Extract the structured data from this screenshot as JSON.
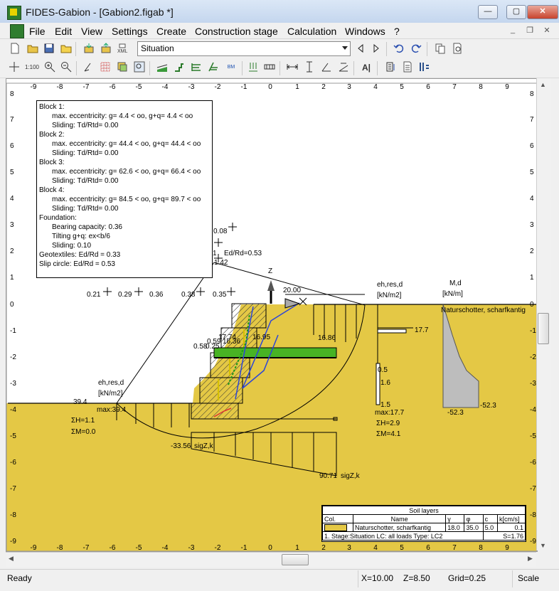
{
  "window": {
    "title": "FIDES-Gabion - [Gabion2.figab *]",
    "minimize_glyph": "—",
    "maximize_glyph": "▢",
    "close_glyph": "✕"
  },
  "menu": {
    "items": [
      "File",
      "Edit",
      "View",
      "Settings",
      "Create",
      "Construction stage",
      "Calculation",
      "Windows",
      "?"
    ],
    "mdi_minimize": "_",
    "mdi_restore": "❐",
    "mdi_close": "✕"
  },
  "toolbar": {
    "view_select": "Situation",
    "scale_label": "1:100",
    "ai_label": "A|",
    "bm_label": "BM"
  },
  "canvas": {
    "x_ticks": [
      "-9",
      "-8",
      "-7",
      "-6",
      "-5",
      "-4",
      "-3",
      "-2",
      "-1",
      "0",
      "1",
      "2",
      "3",
      "4",
      "5",
      "6",
      "7",
      "8",
      "9"
    ],
    "y_ticks": [
      "8",
      "7",
      "6",
      "5",
      "4",
      "3",
      "2",
      "1",
      "0",
      "-1",
      "-2",
      "-3",
      "-4",
      "-5",
      "-6",
      "-7",
      "-8",
      "-9"
    ],
    "soil_color": "#e4c845",
    "axis_label_z": "Z",
    "load_label": "20.00",
    "labels": {
      "ed_rd": "Ed/Rd=0.53",
      "v008": "0.08",
      "v142": "1.42",
      "one": "1",
      "pt021": "0.21",
      "pt029": "0.29",
      "pt036": "0.36",
      "pt038": "0.38",
      "pt035": "0.35",
      "v1774": "17.74",
      "v1695": "16.95",
      "v1686": "16.86",
      "v059": "0.59",
      "v1636": "16.36",
      "v058": "0.58",
      "v025": "0.25",
      "eh_left_1": "eh,res,d",
      "eh_left_2": "[kN/m2]",
      "v394": "39.4",
      "max394": "max:39.4",
      "sumh_left": "ΣH=1.1",
      "summ_left": "ΣM=0.0",
      "v3356": "-33.56",
      "sigz1": "sigZ,k",
      "v9071": "90.71",
      "sigz2": "sigZ,k",
      "eh_right_1": "eh,res,d",
      "eh_right_2": "[kN/m2]",
      "v177": "17.7",
      "v05": "0.5",
      "v16": "1.6",
      "v15": "1.5",
      "max177": "max:17.7",
      "sumh_right": "ΣH=2.9",
      "summ_right": "ΣM=4.1",
      "md_1": "M,d",
      "md_2": "[kN/m]",
      "soil_name": "Naturschotter, scharfkantig",
      "v523a": "-52.3",
      "v523b": "-52.3"
    }
  },
  "info": {
    "lines": [
      {
        "t": "Block 1:",
        "i": false
      },
      {
        "t": "max. eccentricity: g=  4.4 < oo, g+q=  4.4 < oo",
        "i": true
      },
      {
        "t": "Sliding: Td/Rtd= 0.00",
        "i": true
      },
      {
        "t": "Block 2:",
        "i": false
      },
      {
        "t": "max. eccentricity: g= 44.4 < oo, g+q= 44.4 < oo",
        "i": true
      },
      {
        "t": "Sliding: Td/Rtd= 0.00",
        "i": true
      },
      {
        "t": "Block 3:",
        "i": false
      },
      {
        "t": "max. eccentricity: g= 62.6 < oo, g+q= 66.4 < oo",
        "i": true
      },
      {
        "t": "Sliding: Td/Rtd= 0.00",
        "i": true
      },
      {
        "t": "Block 4:",
        "i": false
      },
      {
        "t": "max. eccentricity: g= 84.5 < oo, g+q= 89.7 < oo",
        "i": true
      },
      {
        "t": "Sliding: Td/Rtd= 0.00",
        "i": true
      },
      {
        "t": "Foundation:",
        "i": false
      },
      {
        "t": "Bearing capacity: 0.36",
        "i": true
      },
      {
        "t": "Tilting g+q: ex<b/6",
        "i": true
      },
      {
        "t": "Sliding: 0.10",
        "i": true
      },
      {
        "t": "Geotextiles: Ed/Rd =  0.33",
        "i": false
      },
      {
        "t": "Slip circle: Ed/Rd = 0.53",
        "i": false
      }
    ]
  },
  "soil_table": {
    "title": "Soil layers",
    "headers": [
      "Col.",
      "Name",
      "γ",
      "φ",
      "c",
      "k[cm/s]"
    ],
    "row": [
      "Naturschotter, scharfkantig",
      "18.0",
      "35.0",
      "5.0",
      "0.1"
    ],
    "footer": "1. Stage:Situation LC:  all loads  Type: LC2",
    "factor": "S=1.76"
  },
  "status": {
    "ready": "Ready",
    "x": "X=10.00",
    "z": "Z=8.50",
    "grid": "Grid=0.25",
    "scale": "Scale"
  }
}
